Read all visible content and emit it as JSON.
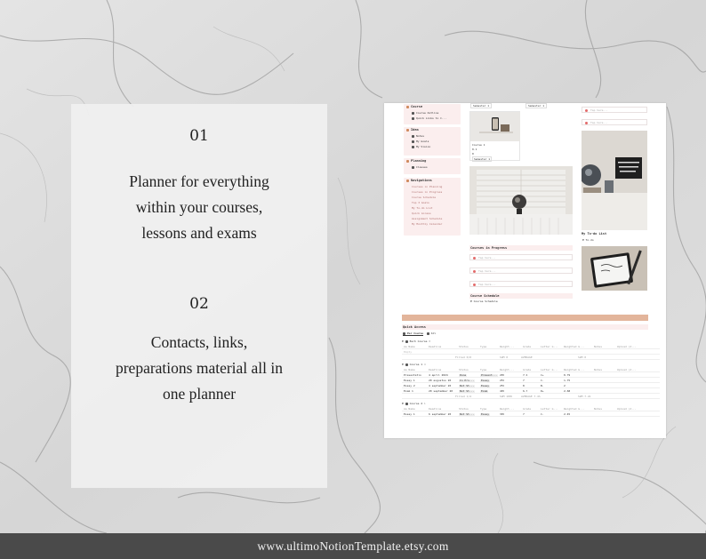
{
  "marketing": {
    "item1_number": "01",
    "item1_lines": [
      "Planner for everything",
      "within your courses,",
      "lessons and exams"
    ],
    "item2_number": "02",
    "item2_lines": [
      "Contacts, links,",
      "preparations material all in",
      "one planner"
    ],
    "footer_url": "www.ultimoNotionTemplate.etsy.com"
  },
  "notion": {
    "sidebar": {
      "course": {
        "title": "Course",
        "items": [
          "Course Outline",
          "Quick Links to C..."
        ]
      },
      "idea": {
        "title": "Idea",
        "items": [
          "Notes",
          "My Goals",
          "My Vision"
        ]
      },
      "planning": {
        "title": "Planning",
        "items": [
          "Classes"
        ]
      },
      "navigations": {
        "title": "Navigations",
        "items": [
          "Courses in Planning",
          "Courses in Progress",
          "Course Schedule",
          "Top 3 Goals",
          "My To-do List",
          "Quick Access",
          "Assignment Schedule",
          "My Monthly Calendar"
        ]
      }
    },
    "semester_label": "Semester 1",
    "course_card": {
      "title": "Course 1",
      "line1": "0.1",
      "line2": "0",
      "semester": "Semester 1"
    },
    "todo_placeholder": "Tap here...",
    "courses_in_progress": "Courses in Progress",
    "course_schedule": "Course Schedule",
    "course_schedule_toggle": "Course Schedule",
    "my_todo_list": "My To-do List",
    "todo_toggle": "To-do",
    "quick_access": "Quick Access",
    "tabs": [
      "Per Course",
      "All"
    ],
    "table": {
      "columns": [
        "Aa Name",
        "Deadline",
        "Status",
        "Type",
        "Weight...",
        "Grade",
        "Letter G...",
        "Weighted G...",
        "Notes",
        "Upload (d..."
      ],
      "group0": {
        "label": "Each Course",
        "count": "0",
        "empty": "Empty",
        "summary": [
          "Filled 0/0",
          "SUM 0",
          "AVERAGE",
          "SUM 0"
        ]
      },
      "group1": {
        "label": "Course 1",
        "count": "4",
        "rows": [
          {
            "name": "Presentatio",
            "deadline": "4 april 2024",
            "status": "Done",
            "type": "Present...",
            "weight": "20%",
            "grade": "7.9",
            "letter": "C+",
            "weighted": "0.79"
          },
          {
            "name": "Essay 1",
            "deadline": "20 augustus 20",
            "status": "In Pro...",
            "type": "Essay",
            "weight": "25%",
            "grade": "7",
            "letter": "C-",
            "weighted": "1.75"
          },
          {
            "name": "Essay 2",
            "deadline": "4 september 20",
            "status": "Not St...",
            "type": "Essay",
            "weight": "25%",
            "grade": "8",
            "letter": "B-",
            "weighted": "2"
          },
          {
            "name": "Exam 1",
            "deadline": "20 september 20",
            "status": "Not St...",
            "type": "Exam",
            "weight": "40%",
            "grade": "6.7",
            "letter": "D+",
            "weighted": "2.68"
          }
        ],
        "summary": [
          "Filled 1/4",
          "SUM 100%",
          "AVERAGE 7.4%",
          "SUM 7.22"
        ]
      },
      "group2": {
        "label": "Course 2",
        "count": "1",
        "rows": [
          {
            "name": "Essay 1",
            "deadline": "6 september 20",
            "status": "Not St...",
            "type": "Essay",
            "weight": "30%",
            "grade": "7",
            "letter": "C-",
            "weighted": "2.45"
          }
        ]
      }
    }
  },
  "colors": {
    "card_bg": "#f0f0f0",
    "footer_bg": "#4a4a4a",
    "accent_pink": "#fbeeee",
    "accent_peach": "#e3b59b"
  }
}
